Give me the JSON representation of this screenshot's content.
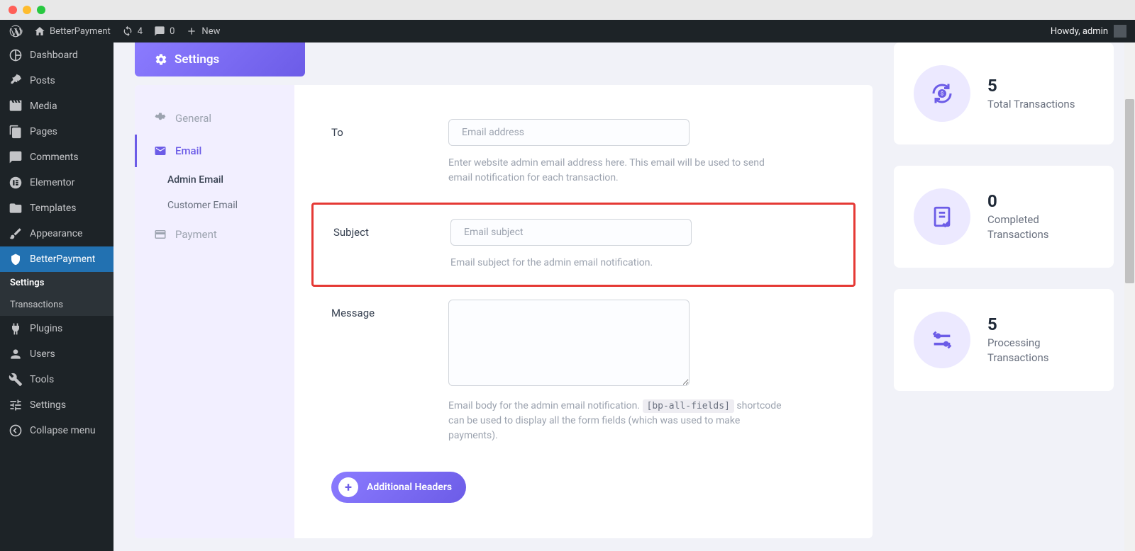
{
  "adminbar": {
    "site_name": "BetterPayment",
    "updates_count": "4",
    "comments_count": "0",
    "new_label": "New",
    "greeting": "Howdy, admin"
  },
  "wp_menu": {
    "dashboard": "Dashboard",
    "posts": "Posts",
    "media": "Media",
    "pages": "Pages",
    "comments": "Comments",
    "elementor": "Elementor",
    "templates": "Templates",
    "appearance": "Appearance",
    "betterpayment": "BetterPayment",
    "bp_settings": "Settings",
    "bp_transactions": "Transactions",
    "plugins": "Plugins",
    "users": "Users",
    "tools": "Tools",
    "settings": "Settings",
    "collapse": "Collapse menu"
  },
  "page": {
    "header": "Settings",
    "tabs": {
      "general": "General",
      "email": "Email",
      "admin_email": "Admin Email",
      "customer_email": "Customer Email",
      "payment": "Payment"
    }
  },
  "fields": {
    "to": {
      "label": "To",
      "placeholder": "Email address",
      "help": "Enter website admin email address here. This email will be used to send email notification for each transaction."
    },
    "subject": {
      "label": "Subject",
      "placeholder": "Email subject",
      "help": "Email subject for the admin email notification."
    },
    "message": {
      "label": "Message",
      "help_before": "Email body for the admin email notification. ",
      "shortcode": "[bp-all-fields]",
      "help_after": " shortcode can be used to display all the form fields (which was used to make payments)."
    },
    "additional_headers": "Additional Headers"
  },
  "stats": {
    "total": {
      "value": "5",
      "label": "Total Transactions"
    },
    "completed": {
      "value": "0",
      "label": "Completed Transactions"
    },
    "processing": {
      "value": "5",
      "label": "Processing Transactions"
    }
  }
}
